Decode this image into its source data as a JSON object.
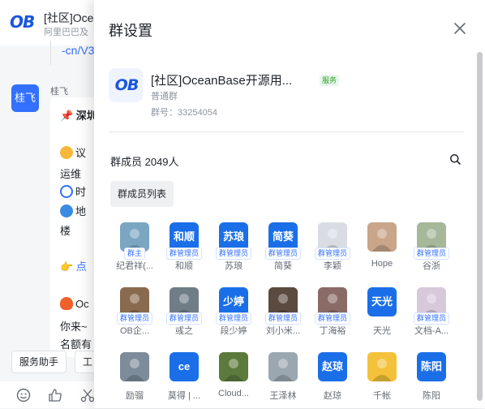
{
  "background_chat": {
    "chat_title": "[社区]Oce",
    "chat_subtitle": "阿里巴巴及",
    "link_fragment": "-cn/V3",
    "sender_avatar_text": "桂飞",
    "sender_name": "桂飞",
    "message_lines": [
      "📌 深圳",
      "议",
      "运维",
      "时",
      "地",
      "楼",
      "👉 点",
      "Oc",
      "你来~",
      "名额有"
    ],
    "toolbar_chips": [
      "服务助手",
      "工"
    ]
  },
  "panel": {
    "title": "群设置",
    "group": {
      "logo_text": "OB",
      "name": "[社区]OceanBase开源用...",
      "tag": "服务",
      "type": "普通群",
      "id_text": "群号：33254054"
    },
    "members_title": "群成员 2049人",
    "member_list_button": "群成员列表",
    "members": [
      {
        "name": "纪君祥(...",
        "badge": "群主",
        "avatar_text": "",
        "avatar_color": "#7aa6c2"
      },
      {
        "name": "和顺",
        "badge": "群管理员",
        "avatar_text": "和顺",
        "avatar_color": "#1a6fe8"
      },
      {
        "name": "苏琅",
        "badge": "群管理员",
        "avatar_text": "苏琅",
        "avatar_color": "#1a6fe8"
      },
      {
        "name": "简葵",
        "badge": "群管理员",
        "avatar_text": "简葵",
        "avatar_color": "#1a6fe8"
      },
      {
        "name": "李颖",
        "badge": "群管理员",
        "avatar_text": "",
        "avatar_color": "#d9dde3"
      },
      {
        "name": "Hope",
        "badge": "",
        "avatar_text": "",
        "avatar_color": "#c9a58a"
      },
      {
        "name": "谷浙",
        "badge": "群管理员",
        "avatar_text": "",
        "avatar_color": "#a7b79a"
      },
      {
        "name": "OB企...",
        "badge": "群管理员",
        "avatar_text": "",
        "avatar_color": "#8a6a4e"
      },
      {
        "name": "彧之",
        "badge": "群管理员",
        "avatar_text": "",
        "avatar_color": "#6f7d86"
      },
      {
        "name": "段少婷",
        "badge": "群管理员",
        "avatar_text": "少婷",
        "avatar_color": "#1a6fe8"
      },
      {
        "name": "刘小米...",
        "badge": "群管理员",
        "avatar_text": "",
        "avatar_color": "#5b4a3f"
      },
      {
        "name": "丁海裕",
        "badge": "群管理员",
        "avatar_text": "",
        "avatar_color": "#8a6b66"
      },
      {
        "name": "天光",
        "badge": "",
        "avatar_text": "天光",
        "avatar_color": "#1a6fe8"
      },
      {
        "name": "文档-A...",
        "badge": "群管理员",
        "avatar_text": "",
        "avatar_color": "#d8c8dc"
      },
      {
        "name": "励骝",
        "badge": "",
        "avatar_text": "",
        "avatar_color": "#7d8c9a"
      },
      {
        "name": "莫得 | ...",
        "badge": "",
        "avatar_text": "ce",
        "avatar_color": "#1a6fe8"
      },
      {
        "name": "Cloud...",
        "badge": "",
        "avatar_text": "",
        "avatar_color": "#5c7a3c"
      },
      {
        "name": "王泽林",
        "badge": "",
        "avatar_text": "",
        "avatar_color": "#9aa7b0"
      },
      {
        "name": "赵琼",
        "badge": "",
        "avatar_text": "赵琼",
        "avatar_color": "#1a6fe8"
      },
      {
        "name": "千帐",
        "badge": "",
        "avatar_text": "",
        "avatar_color": "#f3c23a"
      },
      {
        "name": "陈阳",
        "badge": "",
        "avatar_text": "陈阳",
        "avatar_color": "#1a6fe8"
      }
    ]
  },
  "icons": {
    "close": "close-icon",
    "search": "search-icon",
    "emoji": "emoji-icon",
    "thumbs_up": "thumbs-up-icon",
    "scissors": "scissors-icon"
  },
  "colors": {
    "accent": "#3370ff",
    "avatar_blue": "#1a6fe8",
    "tag_green": "#2ea121"
  }
}
